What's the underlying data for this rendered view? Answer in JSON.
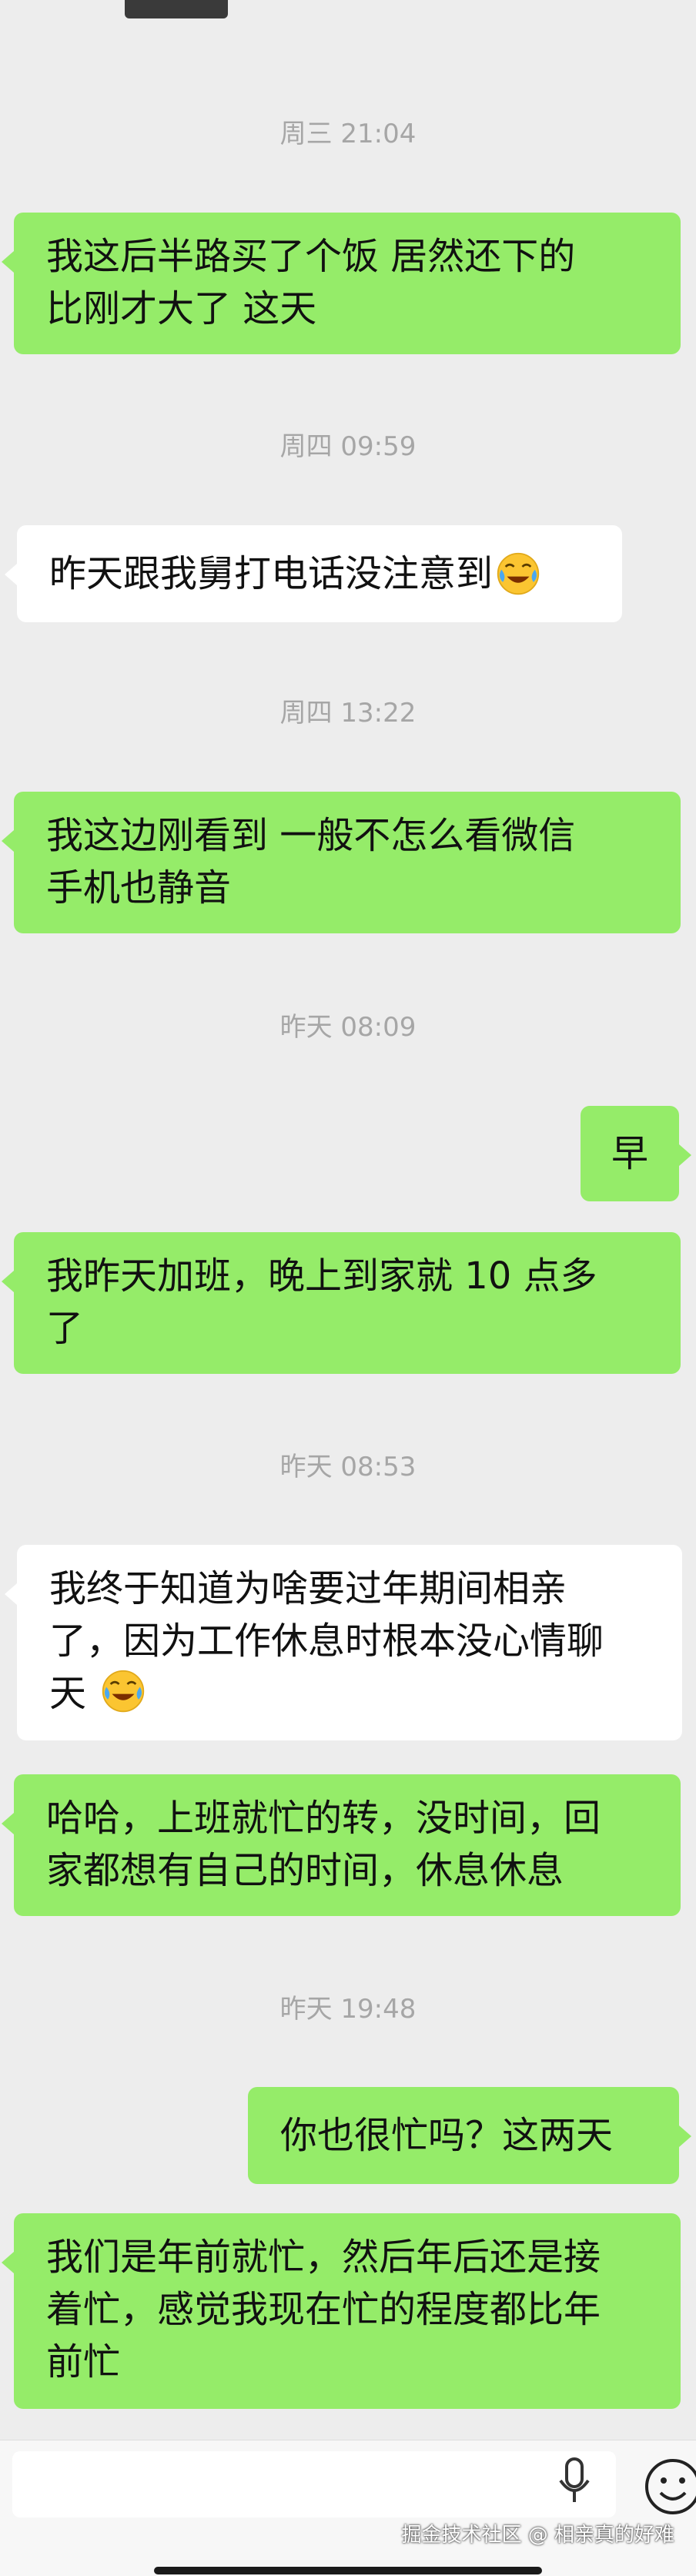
{
  "messages": [
    {
      "type": "time",
      "text": "周三 21:04"
    },
    {
      "type": "msg",
      "side": "left",
      "bubble": "green",
      "lines": [
        "我这后半路买了个饭 居然还下的",
        "比刚才大了 这天"
      ]
    },
    {
      "type": "time",
      "text": "周四 09:59"
    },
    {
      "type": "msg",
      "side": "left",
      "bubble": "white",
      "lines": [
        "昨天跟我舅打电话没注意到"
      ],
      "emoji": "crying-laughing-emoji"
    },
    {
      "type": "time",
      "text": "周四 13:22"
    },
    {
      "type": "msg",
      "side": "left",
      "bubble": "green",
      "lines": [
        "我这边刚看到 一般不怎么看微信",
        "手机也静音"
      ]
    },
    {
      "type": "time",
      "text": "昨天 08:09"
    },
    {
      "type": "msg",
      "side": "right",
      "bubble": "green",
      "lines": [
        "早"
      ]
    },
    {
      "type": "msg",
      "side": "left",
      "bubble": "green",
      "lines": [
        "我昨天加班，晚上到家就 10 点多",
        "了"
      ]
    },
    {
      "type": "time",
      "text": "昨天 08:53"
    },
    {
      "type": "msg",
      "side": "left",
      "bubble": "white",
      "lines": [
        "我终于知道为啥要过年期间相亲",
        "了，因为工作休息时根本没心情聊",
        "天"
      ],
      "emoji": "crying-laughing-emoji"
    },
    {
      "type": "msg",
      "side": "left",
      "bubble": "green",
      "lines": [
        "哈哈，上班就忙的转，没时间，回",
        "家都想有自己的时间，休息休息"
      ]
    },
    {
      "type": "time",
      "text": "昨天 19:48"
    },
    {
      "type": "msg",
      "side": "right",
      "bubble": "green",
      "lines": [
        "你也很忙吗？这两天"
      ]
    },
    {
      "type": "msg",
      "side": "left",
      "bubble": "green",
      "lines": [
        "我们是年前就忙，然后年后还是接",
        "着忙，感觉我现在忙的程度都比年",
        "前忙"
      ]
    }
  ],
  "inputbar": {
    "mic_icon": "microphone-icon",
    "emoji_icon": "smiley-face-icon",
    "watermark": "掘金技术社区 @ 相亲真的好难"
  },
  "colors": {
    "background": "#ededed",
    "bubble_green": "#95ec69",
    "bubble_white": "#ffffff",
    "timestamp": "#a6a6a6"
  }
}
